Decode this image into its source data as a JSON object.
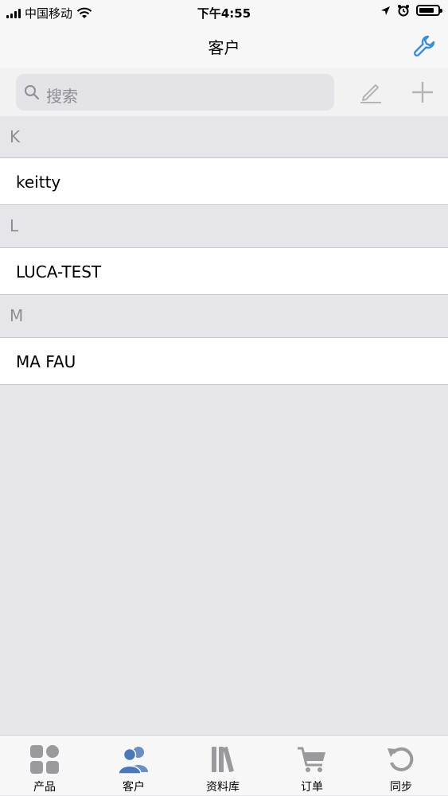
{
  "status_bar": {
    "carrier": "中国移动",
    "time": "下午4:55"
  },
  "nav": {
    "title": "客户",
    "settings_icon": "wrench-icon"
  },
  "search": {
    "placeholder": "搜索"
  },
  "sections": [
    {
      "letter": "K",
      "items": [
        "keitty"
      ]
    },
    {
      "letter": "L",
      "items": [
        "LUCA-TEST"
      ]
    },
    {
      "letter": "M",
      "items": [
        "MA FAU"
      ]
    }
  ],
  "tabs": [
    {
      "label": "产品",
      "icon": "grid-icon"
    },
    {
      "label": "客户",
      "icon": "people-icon"
    },
    {
      "label": "资料库",
      "icon": "books-icon"
    },
    {
      "label": "订单",
      "icon": "cart-icon"
    },
    {
      "label": "同步",
      "icon": "sync-icon"
    }
  ],
  "active_tab": "客户",
  "colors": {
    "accent": "#3b8fd6",
    "tab_inactive": "#8e8e93",
    "tab_active": "#4a78b8"
  }
}
